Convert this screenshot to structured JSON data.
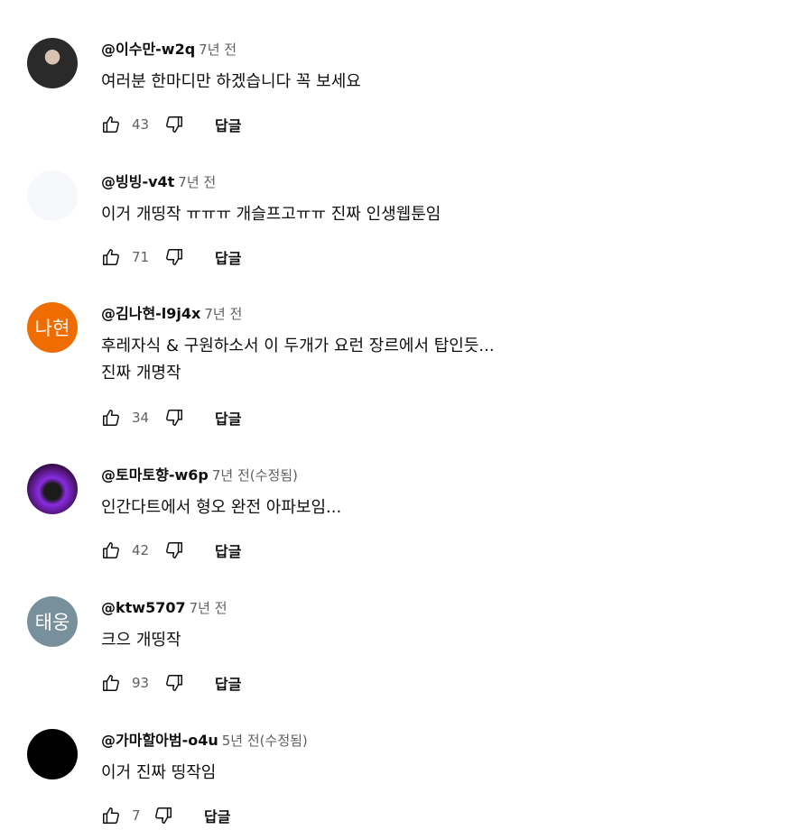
{
  "comments": [
    {
      "author": "@이수만-w2q",
      "time": "7년 전",
      "text_lines": [
        "여러분 한마디만 하겠습니다 꼭 보세요"
      ],
      "likes": "43",
      "avatar_initials": "",
      "avatar_color": "#2a2a2a"
    },
    {
      "author": "@빙빙-v4t",
      "time": "7년 전",
      "text_lines": [
        "이거 개띵작 ㅠㅠㅠ 개슬프고ㅠㅠ 진짜 인생웹툰임"
      ],
      "likes": "71",
      "avatar_initials": "",
      "avatar_color": "#f7f8fc"
    },
    {
      "author": "@김나현-l9j4x",
      "time": "7년 전",
      "text_lines": [
        "후레자식 & 구원하소서 이 두개가 요런 장르에서 탑인듯...",
        "진짜 개명작"
      ],
      "likes": "34",
      "avatar_initials": "나현",
      "avatar_color": "#ef6c00"
    },
    {
      "author": "@토마토향-w6p",
      "time": "7년 전(수정됨)",
      "text_lines": [
        "인간다트에서 형오 완전 아파보임..."
      ],
      "likes": "42",
      "avatar_initials": "",
      "avatar_color": "#5a1a7a"
    },
    {
      "author": "@ktw5707",
      "time": "7년 전",
      "text_lines": [
        "크으 개띵작"
      ],
      "likes": "93",
      "avatar_initials": "태웅",
      "avatar_color": "#78909c"
    },
    {
      "author": "@가마할아범-o4u",
      "time": "5년 전(수정됨)",
      "text_lines": [
        "이거 진짜 띵작임"
      ],
      "likes": "7",
      "avatar_initials": "",
      "avatar_color": "#000000"
    }
  ],
  "reply_label": "답글",
  "icons": {
    "like": "thumbs-up-icon",
    "dislike": "thumbs-down-icon"
  }
}
